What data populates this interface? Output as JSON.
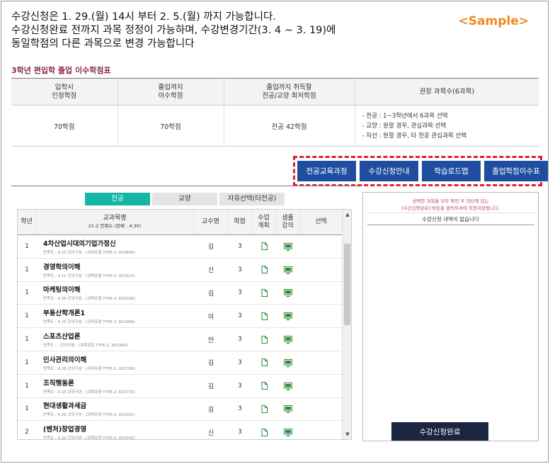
{
  "notice": {
    "line1": "수강신청은 1. 29.(월) 14시 부터 2. 5.(월) 까지 가능합니다.",
    "line2": "수강신청완료 전까지 과목 정정이 가능하며, 수강변경기간(3. 4 ~ 3. 19)에",
    "line3": "동일학점의 다른 과목으로 변경 가능합니다"
  },
  "sample_label": "<Sample>",
  "credit_section": {
    "title": "3학년 편입학 졸업 이수학점표",
    "headers": [
      "입학시\n인정학점",
      "졸업까지\n이수학점",
      "졸업까지 취득할\n전공/교양 최저학점",
      "권장 과목수(6과목)"
    ],
    "values": [
      "70학점",
      "70학점",
      "전공 42학점"
    ],
    "recommend": [
      "- 전공 : 1~3학년에서 6과목 선택",
      "- 교양 : 원할 경우, 관심과목 선택",
      "- 자선 : 원할 경우, 타 전공 관심과목 선택"
    ]
  },
  "nav_buttons": [
    "전공교육과정",
    "수강신청안내",
    "학습로드맵",
    "졸업학점이수표"
  ],
  "tabs": [
    "전공",
    "교양",
    "자유선택(타전공)"
  ],
  "course_table": {
    "headers": {
      "year": "학년",
      "name": "교과목명",
      "name_sub": "21-2 만족도 (전체 : 4.30)",
      "prof": "교수명",
      "credit": "학점",
      "plan": "수업\n계획",
      "video": "샘플\n강의",
      "select": "선택"
    },
    "rows": [
      {
        "year": "1",
        "name": "4차산업시대의기업가정신",
        "meta": "만족도 : 4.23     강의구분 : (과목유형 TYPE-2, 602806)",
        "prof": "김",
        "credit": "3"
      },
      {
        "year": "1",
        "name": "경영학의이해",
        "meta": "만족도 : 4.12     강의구분 : (과목유형 TYPE-2, 601623)",
        "prof": "신",
        "credit": "3"
      },
      {
        "year": "1",
        "name": "마케팅의이해",
        "meta": "만족도 : 4.26     강의구분 : (과목유형 TYPE-2, 600168)",
        "prof": "김",
        "credit": "3"
      },
      {
        "year": "1",
        "name": "부동산학개론1",
        "meta": "만족도 : 4.25     강의구분 : (과목유형 TYPE-2, 601968)",
        "prof": "이",
        "credit": "3"
      },
      {
        "year": "1",
        "name": "스포츠산업론",
        "meta": "만족도 : -     강의구분 : (과목유형 TYPE-2, 603364)",
        "prof": "안",
        "credit": "3"
      },
      {
        "year": "1",
        "name": "인사관리의이해",
        "meta": "만족도 : 4.28     강의구분 : (과목유형 TYPE-2, 601769)",
        "prof": "김",
        "credit": "3"
      },
      {
        "year": "1",
        "name": "조직행동론",
        "meta": "만족도 : 4.15     강의구분 : (과목유형 TYPE-2, 601773)",
        "prof": "김",
        "credit": "3"
      },
      {
        "year": "1",
        "name": "현대생활과세금",
        "meta": "만족도 : 4.26     강의구분 : (과목유형 TYPE-2, 602301)",
        "prof": "김",
        "credit": "3"
      },
      {
        "year": "2",
        "name": "(벤처)창업경영",
        "meta": "만족도 : 4.20     강의구분 : (과목유형 TYPE-2, 602943)",
        "prof": "신",
        "credit": "3"
      }
    ]
  },
  "side_panel": {
    "note_line1": "선택한 과목을 모두 확인 후 하단에 있는",
    "note_line2": "[수강신청완료] 버튼을 클릭하셔야 최종저장됩니다.",
    "empty_text": "수강신청 내역이 없습니다",
    "done_button": "수강신청완료"
  },
  "colors": {
    "nav_button": "#1f4ea0",
    "active_tab": "#14b6a6",
    "done_button": "#1b2440",
    "highlight_box": "#e0202a",
    "doc_icon": "#2f8a3b",
    "sample": "#f28a1c"
  }
}
